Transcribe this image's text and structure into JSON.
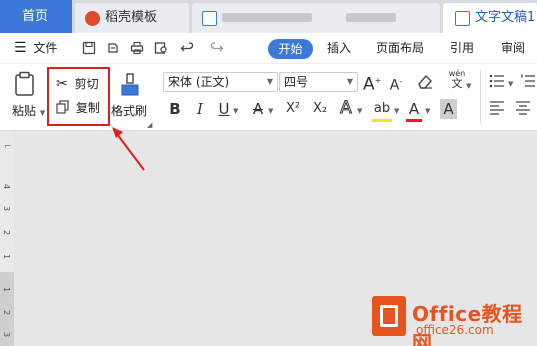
{
  "tabs": {
    "home": "首页",
    "template": "稻壳模板",
    "active": "文字文稿1"
  },
  "menu": {
    "file": "文件",
    "start": "开始",
    "insert": "插入",
    "layout": "页面布局",
    "references": "引用",
    "review": "审阅"
  },
  "ribbon": {
    "paste": "粘贴",
    "cut": "剪切",
    "copy": "复制",
    "format_painter": "格式刷",
    "font_name": "宋体 (正文)",
    "font_size": "四号",
    "phonetic": "wén",
    "buttons": {
      "bold": "B",
      "italic": "I",
      "underline": "U",
      "strike": "A",
      "superscript": "X²",
      "subscript": "X₂",
      "grow": "A",
      "shrink": "A",
      "text_effect": "A",
      "highlight": "ab",
      "font_color": "A",
      "shade": "A"
    }
  },
  "ruler_numbers": [
    "4",
    "3",
    "2",
    "1",
    "1",
    "2",
    "3"
  ],
  "watermark": {
    "title": "Office教程网",
    "site": "office26.com"
  },
  "colors": {
    "accent": "#3b78d8",
    "highlight_box": "#e0201f",
    "arrow": "#e0201f",
    "watermark": "#e8541e"
  }
}
